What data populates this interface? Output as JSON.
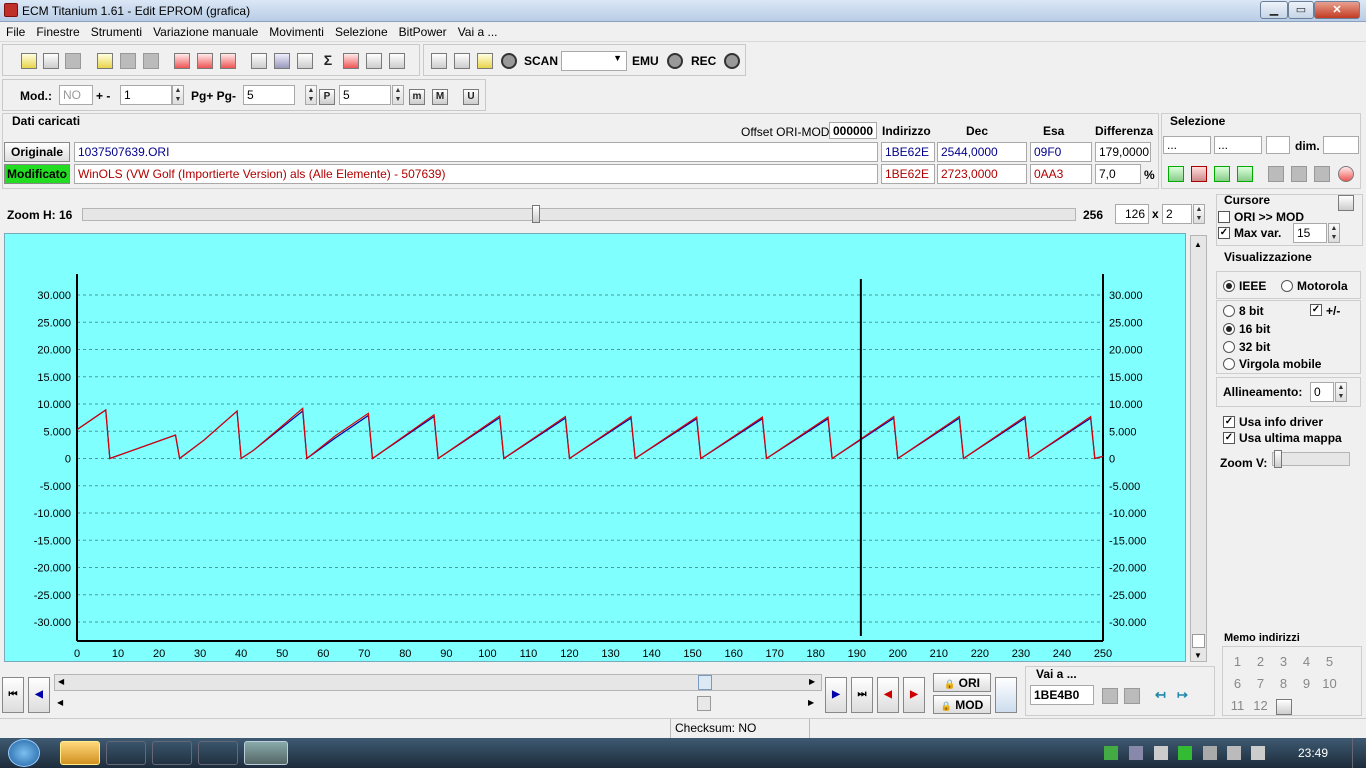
{
  "window": {
    "title": "ECM Titanium 1.61 - Edit EPROM (grafica)",
    "minimize": "▁",
    "maximize": "▭",
    "close": "✕"
  },
  "menu": [
    "File",
    "Finestre",
    "Strumenti",
    "Variazione manuale",
    "Movimenti",
    "Selezione",
    "BitPower",
    "Vai a ..."
  ],
  "toolbar": {
    "scan": "SCAN",
    "emu": "EMU",
    "rec": "REC",
    "mod_label": "Mod.:",
    "mod_value": "NO",
    "plusminus_label": "+ -",
    "plusminus_value": "1",
    "pg_label": "Pg+ Pg-",
    "pg_value": "5",
    "p_value": "5",
    "icon_p": "P",
    "icon_m1": "m",
    "icon_m2": "M",
    "icon_u": "U"
  },
  "loaded": {
    "section_title": "Dati caricati",
    "offset_label": "Offset ORI-MOD",
    "offset_value": "000000",
    "col_address": "Indirizzo",
    "col_dec": "Dec",
    "col_hex": "Esa",
    "col_diff": "Differenza",
    "original": {
      "label": "Originale",
      "file": "1037507639.ORI",
      "address": "1BE62E",
      "dec": "2544,0000",
      "hex": "09F0",
      "diff": "179,0000"
    },
    "modified": {
      "label": "Modificato",
      "file": "WinOLS (VW Golf (Importierte Version) als (Alle Elemente) - 507639)",
      "address": "1BE62E",
      "dec": "2723,0000",
      "hex": "0AA3",
      "diff": "7,0",
      "pct": "%"
    }
  },
  "selection": {
    "title": "Selezione",
    "f1": "...",
    "f2": "...",
    "dim_label": "dim."
  },
  "zoom": {
    "label": "Zoom H: 16",
    "max": "256",
    "w": "126",
    "x_sign": "x",
    "h": "2"
  },
  "cursor": {
    "title": "Cursore",
    "ori_mod": "ORI >> MOD",
    "max_var": "Max var.",
    "max_var_value": "15"
  },
  "view": {
    "title": "Visualizzazione",
    "ieee": "IEEE",
    "motorola": "Motorola",
    "b8": "8 bit",
    "plusminus": "+/-",
    "b16": "16 bit",
    "b32": "32 bit",
    "float": "Virgola mobile",
    "align_label": "Allineamento:",
    "align_value": "0",
    "driver": "Usa info driver",
    "lastmap": "Usa ultima mappa",
    "zoomv": "Zoom V:"
  },
  "memo": {
    "title": "Memo indirizzi",
    "numbers": [
      "1",
      "2",
      "3",
      "4",
      "5",
      "6",
      "7",
      "8",
      "9",
      "10",
      "11",
      "12"
    ]
  },
  "nav": {
    "goto_label": "Vai a ...",
    "goto_value": "1BE4B0",
    "ori": "ORI",
    "mod": "MOD"
  },
  "status": {
    "checksum": "Checksum: NO"
  },
  "taskbar": {
    "clock": "23:49"
  },
  "chart_data": {
    "type": "line",
    "xlim": [
      0,
      250
    ],
    "ylim": [
      -32500,
      32500
    ],
    "grid": true,
    "legend": "none",
    "x_ticks": [
      0,
      10,
      20,
      30,
      40,
      50,
      60,
      70,
      80,
      90,
      100,
      110,
      120,
      130,
      140,
      150,
      160,
      170,
      180,
      190,
      200,
      210,
      220,
      230,
      240,
      250
    ],
    "y_ticks": [
      30000,
      25000,
      20000,
      15000,
      10000,
      5000,
      0,
      -5000,
      -10000,
      -15000,
      -20000,
      -25000,
      -30000
    ],
    "y_tick_labels": [
      "30.000",
      "25.000",
      "20.000",
      "15.000",
      "10.000",
      "5.000",
      "0",
      "-5.000",
      "-10.000",
      "-15.000",
      "-20.000",
      "-25.000",
      "-30.000"
    ],
    "cursor_x": 191,
    "colors": {
      "ori": "#0000aa",
      "mod": "#dd0000",
      "background": "#80ffff"
    },
    "series": [
      {
        "key": "ori",
        "x": [
          0,
          7,
          8,
          24,
          25,
          31,
          39,
          40,
          43,
          55,
          56,
          63,
          71,
          72,
          87,
          88,
          103,
          104,
          119,
          120,
          135,
          136,
          151,
          152,
          167,
          168,
          183,
          184,
          199,
          200,
          215,
          216,
          231,
          232,
          247,
          248,
          250
        ],
        "y": [
          5300,
          8900,
          0,
          4300,
          0,
          3400,
          8700,
          0,
          1500,
          8700,
          0,
          3800,
          7900,
          0,
          7700,
          0,
          7500,
          0,
          7400,
          0,
          7400,
          0,
          7300,
          0,
          7300,
          0,
          7300,
          0,
          7400,
          0,
          7400,
          0,
          7400,
          0,
          7400,
          0,
          400
        ]
      },
      {
        "key": "mod",
        "x": [
          0,
          7,
          8,
          24,
          25,
          31,
          39,
          40,
          43,
          55,
          56,
          63,
          71,
          72,
          87,
          88,
          103,
          104,
          119,
          120,
          135,
          136,
          151,
          152,
          167,
          168,
          183,
          184,
          199,
          200,
          215,
          216,
          231,
          232,
          247,
          248,
          250
        ],
        "y": [
          5300,
          8900,
          0,
          4300,
          0,
          3400,
          8700,
          0,
          1500,
          9200,
          0,
          4200,
          8300,
          0,
          8000,
          0,
          7800,
          0,
          7700,
          0,
          7700,
          0,
          7600,
          0,
          7600,
          0,
          7600,
          0,
          7700,
          0,
          7700,
          0,
          7700,
          0,
          7700,
          0,
          400
        ]
      }
    ]
  }
}
